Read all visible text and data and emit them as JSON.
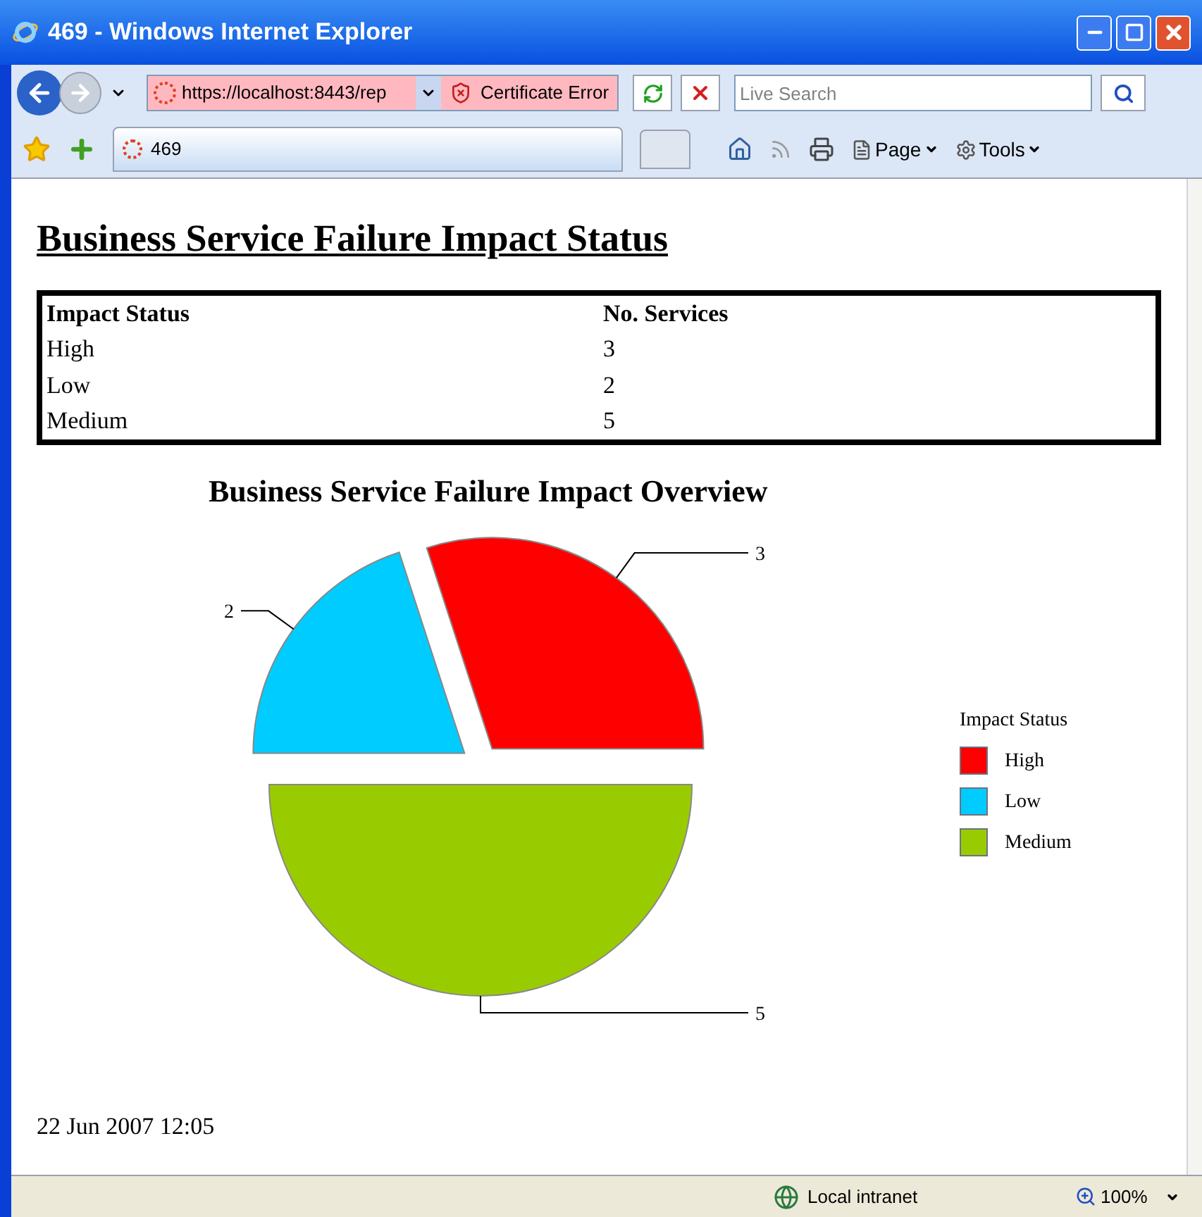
{
  "window": {
    "title": "469 - Windows Internet Explorer"
  },
  "address_bar": {
    "url": "https://localhost:8443/rep",
    "certificate": "Certificate Error"
  },
  "search": {
    "placeholder": "Live Search"
  },
  "tabs": [
    {
      "label": "469",
      "selected": true
    }
  ],
  "toolbar": [
    "Page",
    "Tools"
  ],
  "page": {
    "heading": "Business Service Failure Impact Status",
    "table": {
      "columns": [
        "Impact Status",
        "No. Services"
      ],
      "rows": [
        [
          "High",
          "3"
        ],
        [
          "Low",
          "2"
        ],
        [
          "Medium",
          "5"
        ]
      ]
    },
    "chart": {
      "chart_data": {
        "type": "pie",
        "title": "Business Service Failure Impact Overview",
        "categories": [
          "High",
          "Low",
          "Medium"
        ],
        "values": [
          3,
          2,
          5
        ],
        "colors": [
          "#ff0000",
          "#00ccff",
          "#99cc00"
        ],
        "data_labels": true,
        "legend": {
          "title": "Impact Status"
        }
      }
    },
    "timestamp": "22 Jun 2007 12:05"
  },
  "status_bar": {
    "zone": "Local intranet",
    "zoom": "100%"
  }
}
